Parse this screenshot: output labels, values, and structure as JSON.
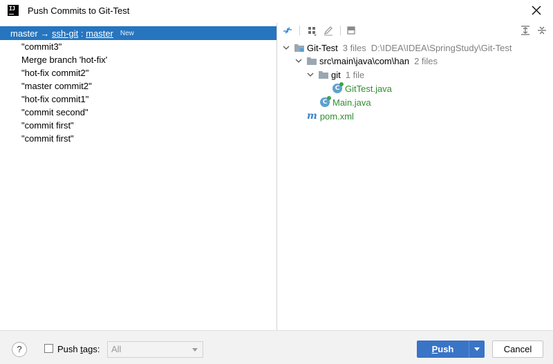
{
  "window": {
    "title": "Push Commits to Git-Test",
    "app_icon": "IJ"
  },
  "branch": {
    "local": "master",
    "arrow": "→",
    "remote": "ssh-git",
    "colon": ":",
    "target": "master",
    "badge": "New"
  },
  "commits": [
    "\"commit3\"",
    "Merge branch 'hot-fix'",
    "\"hot-fix commit2\"",
    "\"master commit2\"",
    "\"hot-fix commit1\"",
    "\"commit second\"",
    "\"commit first\"",
    "\"commit first\""
  ],
  "tree": {
    "root": {
      "name": "Git-Test",
      "count": "3 files",
      "path": "D:\\IDEA\\IDEA\\SpringStudy\\Git-Test"
    },
    "src": {
      "name": "src\\main\\java\\com\\han",
      "count": "2 files"
    },
    "git_dir": {
      "name": "git",
      "count": "1 file"
    },
    "file1": "GitTest.java",
    "file2": "Main.java",
    "file3": "pom.xml"
  },
  "bottom": {
    "help": "?",
    "push_tags_prefix": "Push ",
    "push_tags_underlined": "t",
    "push_tags_suffix": "ags:",
    "tags_value": "All",
    "push_prefix": "",
    "push_underlined": "P",
    "push_suffix": "ush",
    "cancel": "Cancel"
  },
  "colors": {
    "selection": "#2675bf",
    "primary_button": "#3974c7",
    "changed_file": "#2f8f2f"
  }
}
